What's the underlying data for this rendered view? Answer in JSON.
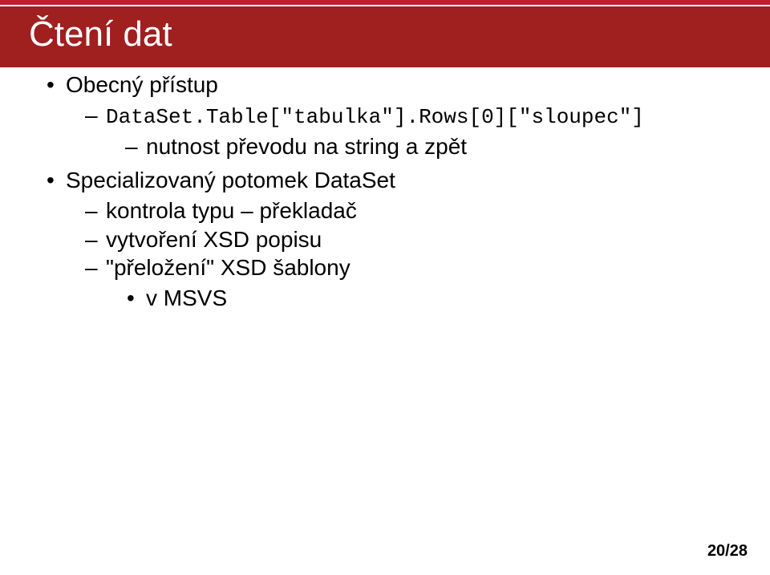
{
  "title": "Čtení dat",
  "content": {
    "items": [
      {
        "label": "Obecný přístup",
        "sub": [
          {
            "code": "DataSet.Table[\"tabulka\"].Rows[0][\"sloupec\"]",
            "sub": [
              {
                "label": "nutnost převodu na string a zpět"
              }
            ]
          }
        ]
      },
      {
        "label": "Specializovaný potomek DataSet",
        "sub": [
          {
            "label": "kontrola typu – překladač"
          },
          {
            "label": "vytvoření XSD popisu"
          },
          {
            "label": "\"přeložení\" XSD šablony",
            "sub": [
              {
                "label": "v MSVS"
              }
            ]
          }
        ]
      }
    ]
  },
  "footer": {
    "page": "20/28"
  }
}
